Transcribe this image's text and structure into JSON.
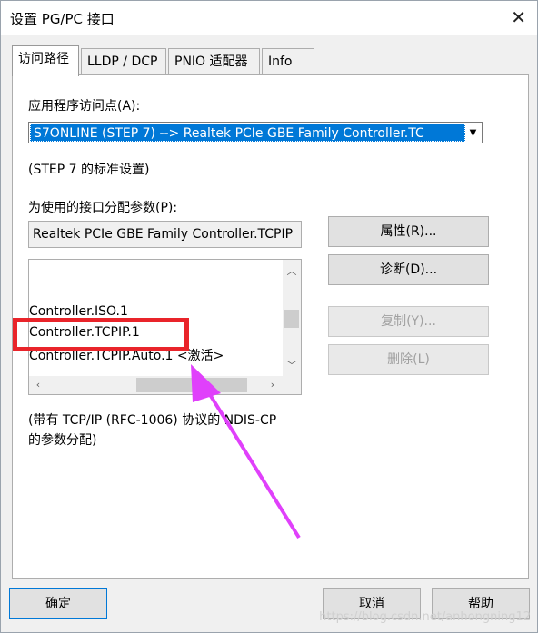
{
  "window": {
    "title": "设置 PG/PC 接口",
    "close_glyph": "✕"
  },
  "tabs": [
    {
      "label": "访问路径",
      "active": true
    },
    {
      "label": "LLDP / DCP",
      "active": false
    },
    {
      "label": "PNIO 适配器",
      "active": false
    },
    {
      "label": "Info",
      "active": false
    }
  ],
  "access_point": {
    "label": "应用程序访问点(A):",
    "selected_value": "S7ONLINE (STEP 7)      --> Realtek PCIe GBE Family Controller.TC",
    "note": "(STEP 7 的标准设置)"
  },
  "interface_params": {
    "label": "为使用的接口分配参数(P):",
    "current_value": "Realtek PCIe GBE Family Controller.TCPIP",
    "list_items": [
      "Controller.ISO.1",
      "Controller.TCPIP.1",
      "Controller.TCPIP.Auto.1    <激活>"
    ],
    "description": "(带有 TCP/IP (RFC-1006) 协议的 NDIS-CP\n的参数分配)"
  },
  "buttons": {
    "properties": "属性(R)...",
    "diagnostics": "诊断(D)...",
    "copy": "复制(Y)...",
    "delete": "删除(L)",
    "ok": "确定",
    "cancel": "取消",
    "help": "帮助"
  },
  "annotation": {
    "highlight_color": "#e9242a",
    "arrow_color": "#e040fb"
  },
  "watermark": "https://blog.csdn.net/anhongning12",
  "colors": {
    "selection": "#0078d7",
    "window_bg": "#f0f0f0"
  }
}
